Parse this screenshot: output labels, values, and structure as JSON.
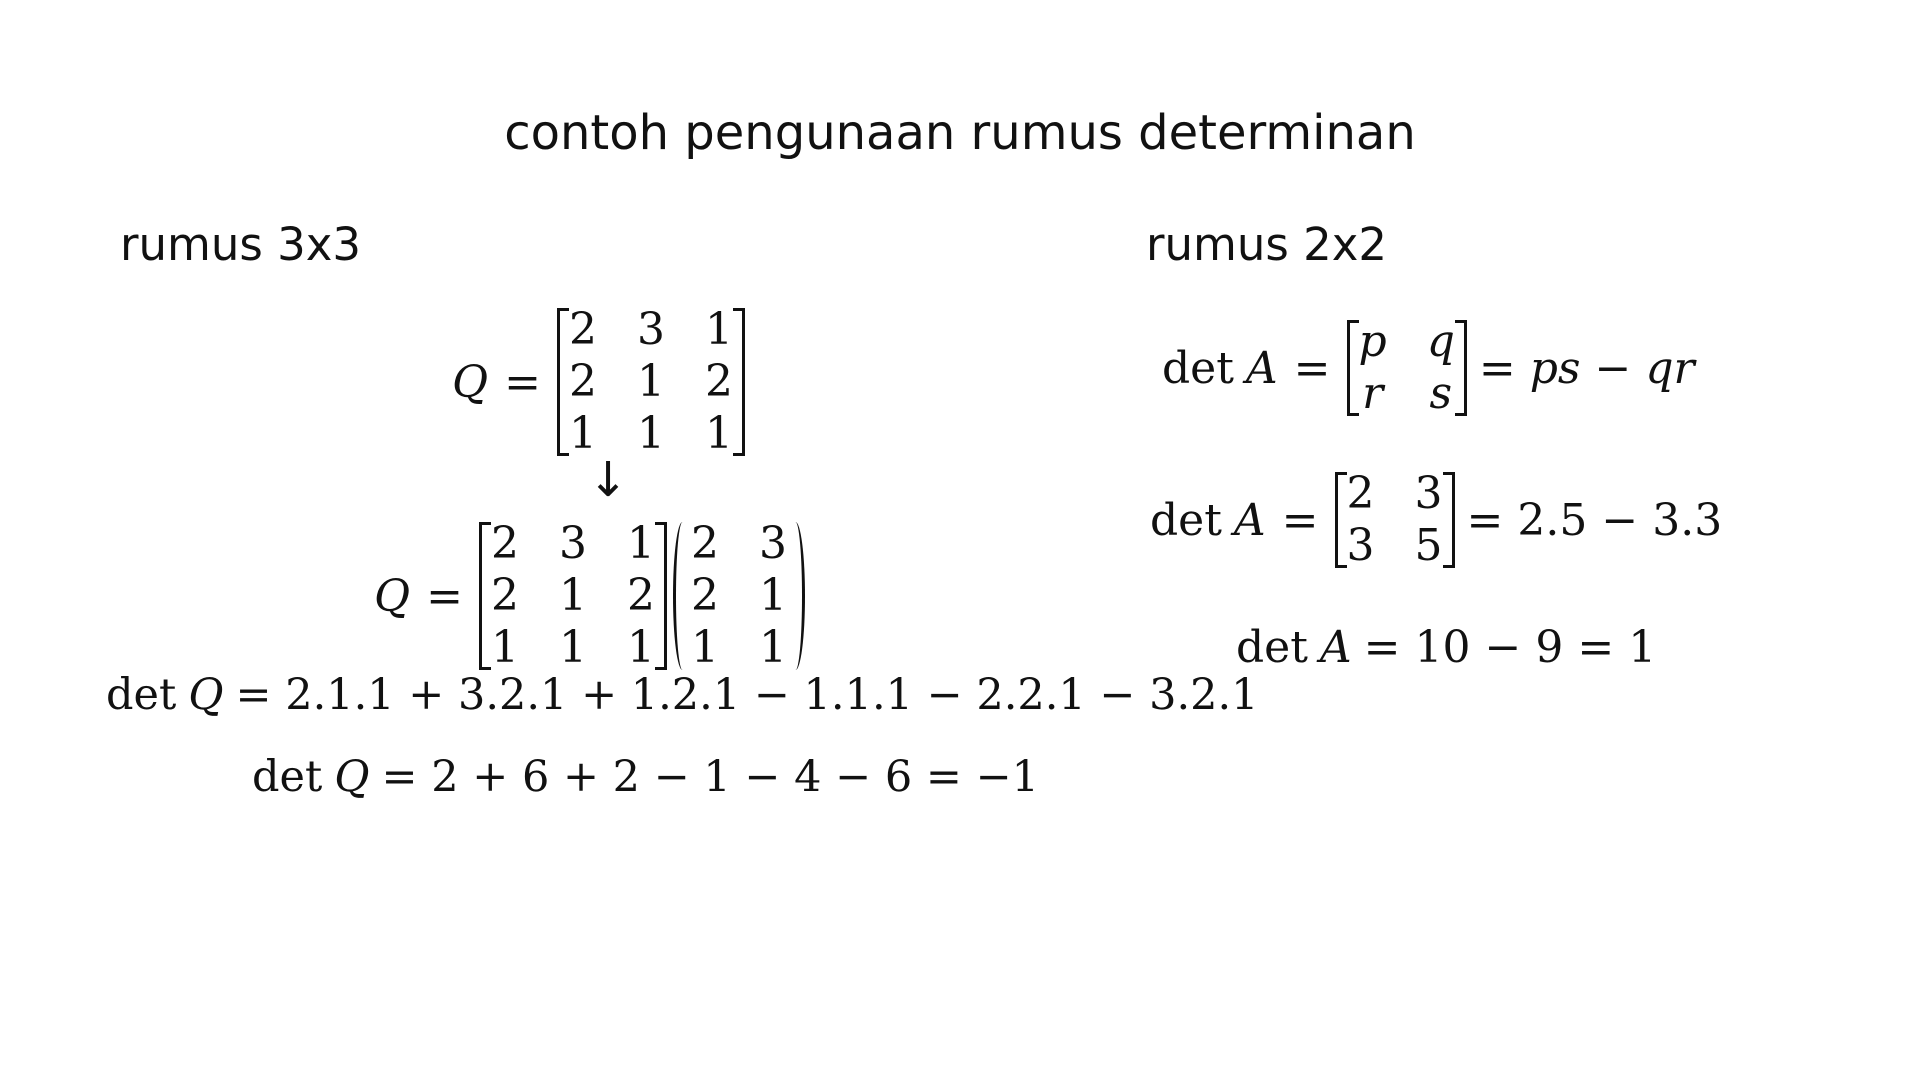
{
  "title": "contoh pengunaan rumus determinan",
  "sections": {
    "left": {
      "heading": "rumus 3x3",
      "matrix_name": "Q",
      "matrix_rows": [
        [
          "2",
          "3",
          "1"
        ],
        [
          "2",
          "1",
          "2"
        ],
        [
          "1",
          "1",
          "1"
        ]
      ],
      "arrow": "↓",
      "extended_rows": [
        [
          "2",
          "3"
        ],
        [
          "2",
          "1"
        ],
        [
          "1",
          "1"
        ]
      ],
      "det_label": "det",
      "det_expansion": "= 2.1.1 + 3.2.1 + 1.2.1 − 1.1.1 − 2.2.1 − 3.2.1",
      "det_result": "= 2 + 6 + 2 − 1 − 4 − 6 = −1"
    },
    "right": {
      "heading": "rumus 2x2",
      "det_label": "det",
      "matrix_name": "A",
      "symbolic_rows": [
        [
          "p",
          "q"
        ],
        [
          "r",
          "s"
        ]
      ],
      "symbolic_result": "= ps −  qr",
      "numeric_rows": [
        [
          "2",
          "3"
        ],
        [
          "3",
          "5"
        ]
      ],
      "numeric_result": "= 2.5 −  3.3",
      "final_result": "= 10 − 9 = 1"
    }
  },
  "symbols": {
    "equals": "="
  }
}
